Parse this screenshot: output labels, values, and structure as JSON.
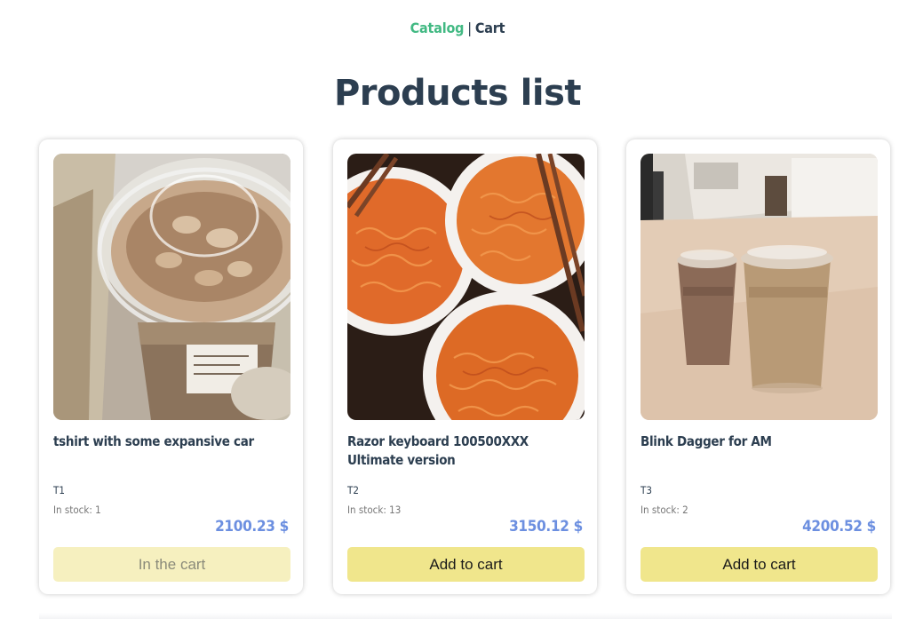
{
  "nav": {
    "catalog_label": "Catalog",
    "separator": "|",
    "cart_label": "Cart"
  },
  "page_title": "Products list",
  "colors": {
    "nav_active": "#42b983",
    "text": "#2c3e50",
    "price": "#6c8fe0",
    "button": "#f0e68c",
    "button_disabled": "#f6f0bf"
  },
  "products": [
    {
      "name": "tshirt with some expansive car",
      "sku": "T1",
      "stock": "In stock: 1",
      "price": "2100.23 $",
      "button_label": "In the cart",
      "in_cart": true,
      "image": "iced-latte-photo"
    },
    {
      "name": "Razor keyboard 100500XXX Ultimate version",
      "sku": "T2",
      "stock": "In stock: 13",
      "price": "3150.12 $",
      "button_label": "Add to cart",
      "in_cart": false,
      "image": "ramen-bowls-photo"
    },
    {
      "name": "Blink Dagger for AM",
      "sku": "T3",
      "stock": "In stock: 2",
      "price": "4200.52 $",
      "button_label": "Add to cart",
      "in_cart": false,
      "image": "iced-coffee-cups-photo"
    }
  ]
}
